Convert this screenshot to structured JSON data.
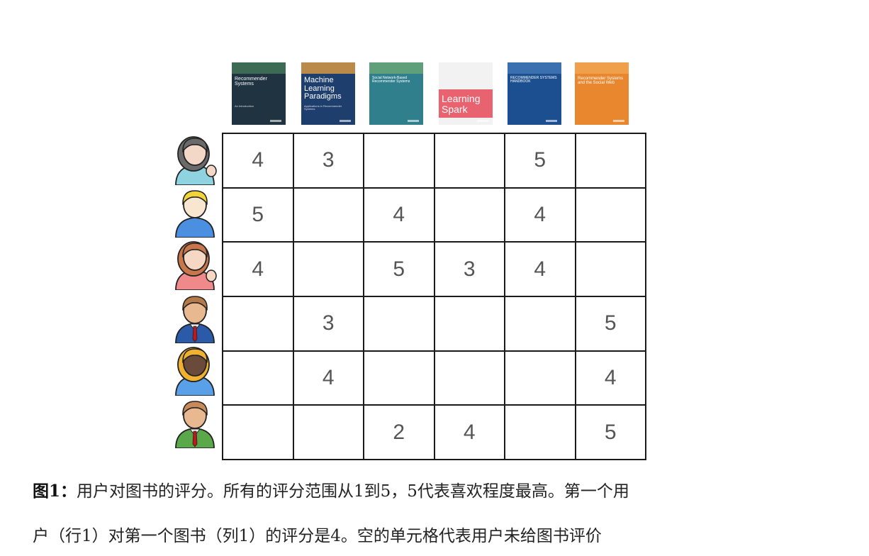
{
  "books": [
    {
      "title": "Recommender Systems",
      "subtitle": "An Introduction",
      "bg": "#1f3340",
      "accent": "#3d6a55",
      "title_size": 7
    },
    {
      "title": "Machine Learning Paradigms",
      "subtitle": "Applications in Recommender Systems",
      "bg": "#1e3e6e",
      "accent": "#b98a4a",
      "title_size": 11
    },
    {
      "title": "Social Network-Based Recommender Systems",
      "subtitle": "",
      "bg": "#2f7f8c",
      "accent": "#5fa07a",
      "title_size": 5
    },
    {
      "title": "Learning Spark",
      "subtitle": "",
      "bg": "#f2f2f2",
      "accent": "#e8636f",
      "title_size": 14
    },
    {
      "title": "RECOMMENDER SYSTEMS HANDBOOK",
      "subtitle": "",
      "bg": "#1c4f8f",
      "accent": "#3a6fb0",
      "title_size": 5
    },
    {
      "title": "Recommender Systems and the Social Web",
      "subtitle": "",
      "bg": "#e8872e",
      "accent": "#f0a04a",
      "title_size": 6
    }
  ],
  "users": [
    {
      "avatar": "woman-gray-hair-waving-icon",
      "hair": "#6a6a6a",
      "skin": "#f3d8c8",
      "shirt": "#8fd3e0"
    },
    {
      "avatar": "boy-blond-icon",
      "hair": "#f2d33a",
      "skin": "#f8e6d0",
      "shirt": "#4a8fe0"
    },
    {
      "avatar": "woman-brown-hair-waving-icon",
      "hair": "#c9774a",
      "skin": "#f6d7c4",
      "shirt": "#f08a8a"
    },
    {
      "avatar": "man-suit-tie-icon",
      "hair": "#b57a4a",
      "skin": "#e8b890",
      "shirt": "#2a5aa8"
    },
    {
      "avatar": "woman-blonde-hair-icon",
      "hair": "#f0b030",
      "skin": "#6a4a3a",
      "shirt": "#5aa0e8"
    },
    {
      "avatar": "man-green-shirt-tie-icon",
      "hair": "#c98a5a",
      "skin": "#e8b890",
      "shirt": "#5aa84a"
    }
  ],
  "ratings": [
    [
      "4",
      "3",
      "",
      "",
      "5",
      ""
    ],
    [
      "5",
      "",
      "4",
      "",
      "4",
      ""
    ],
    [
      "4",
      "",
      "5",
      "3",
      "4",
      ""
    ],
    [
      "",
      "3",
      "",
      "",
      "",
      "5"
    ],
    [
      "",
      "4",
      "",
      "",
      "",
      "4"
    ],
    [
      "",
      "",
      "2",
      "4",
      "",
      "5"
    ]
  ],
  "caption": {
    "label": "图1",
    "separator": "：",
    "line1": "用户对图书的评分。所有的评分范围从1到5，5代表喜欢程度最高。第一个用",
    "line2": "户（行1）对第一个图书（列1）的评分是4。空的单元格代表用户未给图书评价"
  }
}
